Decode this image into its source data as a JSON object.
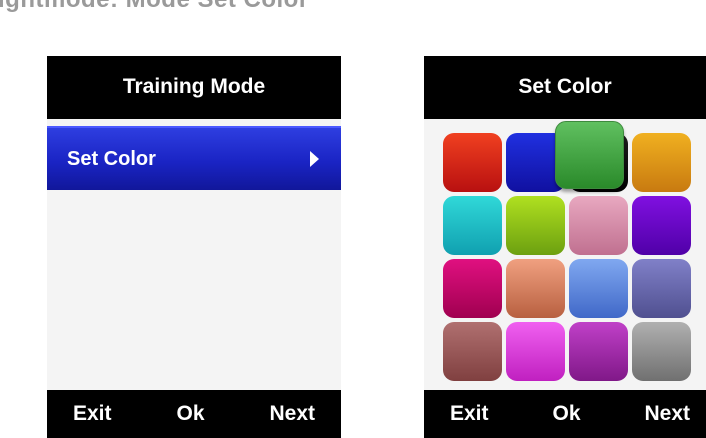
{
  "heading": "ightmode: Mode Set Color",
  "left_screen": {
    "title": "Training Mode",
    "menu_item": "Set Color",
    "footer": {
      "exit": "Exit",
      "ok": "Ok",
      "next": "Next"
    }
  },
  "right_screen": {
    "title": "Set Color",
    "footer": {
      "exit": "Exit",
      "ok": "Ok",
      "next": "Next"
    },
    "selected_swatch": "green",
    "swatches": [
      {
        "name": "red",
        "top": "#f04020",
        "bottom": "#b81010"
      },
      {
        "name": "blue",
        "top": "#2030e0",
        "bottom": "#1010a0"
      },
      {
        "name": "black",
        "top": "#202020",
        "bottom": "#000000"
      },
      {
        "name": "amber",
        "top": "#f0b020",
        "bottom": "#c87a10"
      },
      {
        "name": "cyan",
        "top": "#30d8d8",
        "bottom": "#10a0b0"
      },
      {
        "name": "lime",
        "top": "#b0e020",
        "bottom": "#6ca010"
      },
      {
        "name": "pink",
        "top": "#e8a8c0",
        "bottom": "#c07090"
      },
      {
        "name": "violet",
        "top": "#8010e0",
        "bottom": "#5000a8"
      },
      {
        "name": "magenta",
        "top": "#e01080",
        "bottom": "#a00050"
      },
      {
        "name": "salmon",
        "top": "#f0a080",
        "bottom": "#b86040"
      },
      {
        "name": "cornflower",
        "top": "#80a8f0",
        "bottom": "#4068c8"
      },
      {
        "name": "slate-blue",
        "top": "#8080c8",
        "bottom": "#505090"
      },
      {
        "name": "rosewood",
        "top": "#b07070",
        "bottom": "#804040"
      },
      {
        "name": "orchid",
        "top": "#f060f0",
        "bottom": "#c020c0"
      },
      {
        "name": "purple",
        "top": "#c040c8",
        "bottom": "#801888"
      },
      {
        "name": "gray",
        "top": "#b0b0b0",
        "bottom": "#707070"
      },
      {
        "name": "green",
        "top": "#60c060",
        "bottom": "#2a8a2a"
      }
    ]
  }
}
